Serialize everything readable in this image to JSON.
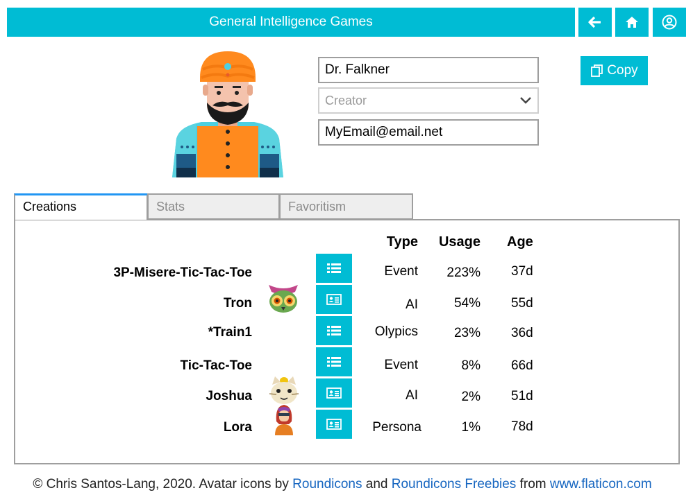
{
  "header": {
    "title": "General Intelligence Games"
  },
  "profile": {
    "name_value": "Dr. Falkner",
    "role_placeholder": "Creator",
    "email_value": "MyEmail@email.net",
    "copy_label": "Copy"
  },
  "tabs": [
    {
      "label": "Creations",
      "active": true
    },
    {
      "label": "Stats",
      "active": false
    },
    {
      "label": "Favoritism",
      "active": false
    }
  ],
  "table": {
    "headers": {
      "type": "Type",
      "usage": "Usage",
      "age": "Age"
    },
    "rows": [
      {
        "name": "3P-Misere-Tic-Tac-Toe",
        "icon": "",
        "action": "list-icon",
        "type": "Event",
        "usage": "223%",
        "age": "37d"
      },
      {
        "name": "Tron",
        "icon": "owl-avatar",
        "action": "id-card-icon",
        "type": "AI",
        "usage": "54%",
        "age": "55d"
      },
      {
        "name": "*Train1",
        "icon": "",
        "action": "list-icon",
        "type": "Olypics",
        "usage": "23%",
        "age": "36d"
      },
      {
        "name": "Tic-Tac-Toe",
        "icon": "",
        "action": "list-icon",
        "type": "Event",
        "usage": "8%",
        "age": "66d"
      },
      {
        "name": "Joshua",
        "icon": "cat-avatar",
        "action": "id-card-icon",
        "type": "AI",
        "usage": "2%",
        "age": "51d"
      },
      {
        "name": "Lora",
        "icon": "woman-avatar",
        "action": "id-card-icon",
        "type": "Persona",
        "usage": "1%",
        "age": "78d"
      }
    ]
  },
  "footer": {
    "prefix": "© Chris Santos-Lang, 2020. Avatar icons by ",
    "link1": "Roundicons",
    "and": " and ",
    "link2": "Roundicons Freebies",
    "from": " from ",
    "link3": "www.flaticon.com"
  },
  "colors": {
    "accent": "#00bcd4",
    "tab_active": "#2196f3",
    "link": "#1565c0"
  }
}
